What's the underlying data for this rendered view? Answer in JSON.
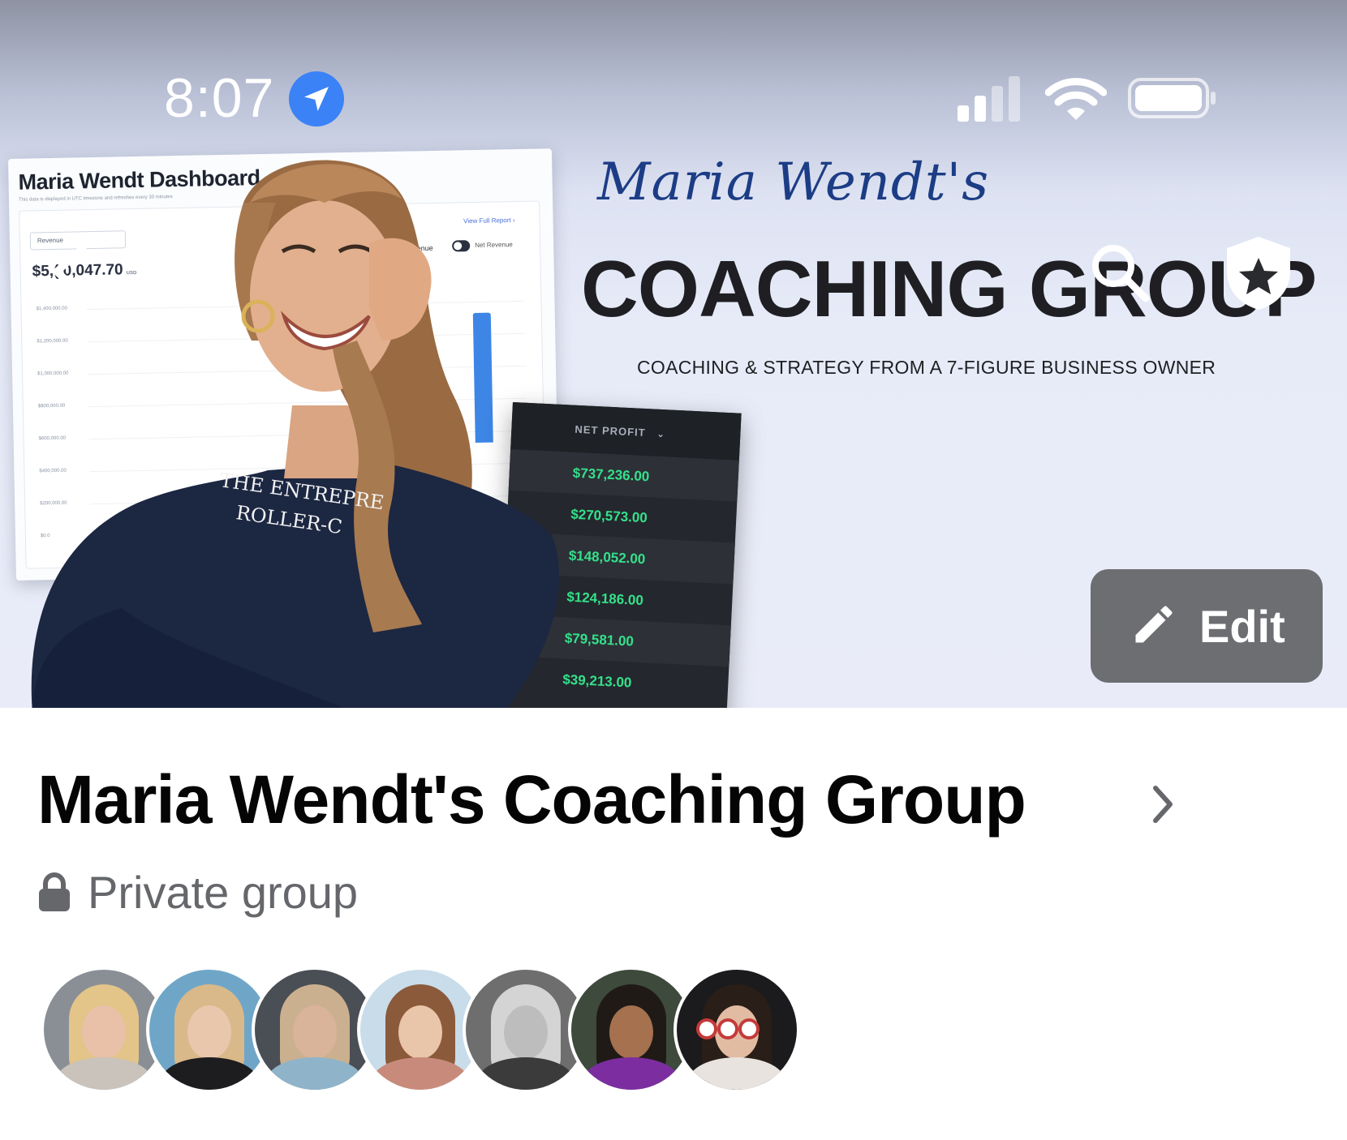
{
  "status_bar": {
    "time": "8:07",
    "icons": [
      "location-arrow-icon",
      "cellular-signal-icon",
      "wifi-icon",
      "battery-icon"
    ]
  },
  "cover": {
    "dashboard": {
      "title": "Maria Wendt Dashboard",
      "subtitle": "This data is displayed in UTC timezone and refreshes every 30 minutes",
      "select_value": "Revenue",
      "amount": "$5,(  0,047.70",
      "currency": "USD",
      "link": "View Full Report ›",
      "toggle_left": "venue",
      "toggle_right": "Net Revenue",
      "ticks": [
        "$1,400,000.00",
        "$1,200,000.00",
        "$1,000,000.00",
        "$800,000.00",
        "$600,000.00",
        "$400,000.00",
        "$200,000.00",
        "$0.0"
      ]
    },
    "net_profit": {
      "header": "NET PROFIT",
      "values": [
        "$737,236.00",
        "$270,573.00",
        "$148,052.00",
        "$124,186.00",
        "$79,581.00",
        "$39,213.00"
      ]
    },
    "shirt_text": [
      "THE ENTREPRE",
      "ROLLER-C"
    ],
    "script_title": "Maria Wendt's",
    "big_title": "COACHING GROUP",
    "tagline": "COACHING & STRATEGY FROM A 7-FIGURE BUSINESS OWNER"
  },
  "controls": {
    "edit_label": "Edit"
  },
  "group": {
    "name": "Maria Wendt's Coaching Group",
    "privacy": "Private group"
  },
  "members": [
    {
      "bg": "#8a8f96",
      "hair": "#e3c489",
      "skin": "#e8c1a8",
      "shirt": "#c9c3bb"
    },
    {
      "bg": "#6fa6c8",
      "hair": "#d9b98a",
      "skin": "#e8c7ad",
      "shirt": "#1d1d1f"
    },
    {
      "bg": "#4a4e55",
      "hair": "#cbb08f",
      "skin": "#d9b39a",
      "shirt": "#8fb4c9"
    },
    {
      "bg": "#c8dcea",
      "hair": "#8b5a3b",
      "skin": "#e9c5a9",
      "shirt": "#c88b7b"
    },
    {
      "bg": "#6e6e6e",
      "hair": "#d4d4d4",
      "skin": "#bdbdbd",
      "shirt": "#3b3b3b"
    },
    {
      "bg": "#3d4a3c",
      "hair": "#201a17",
      "skin": "#a5714f",
      "shirt": "#7c2ea0"
    },
    {
      "bg": "#1b1b1d",
      "hair": "#2a1e18",
      "skin": "#e2bba3",
      "shirt": "#e9e3df"
    }
  ]
}
